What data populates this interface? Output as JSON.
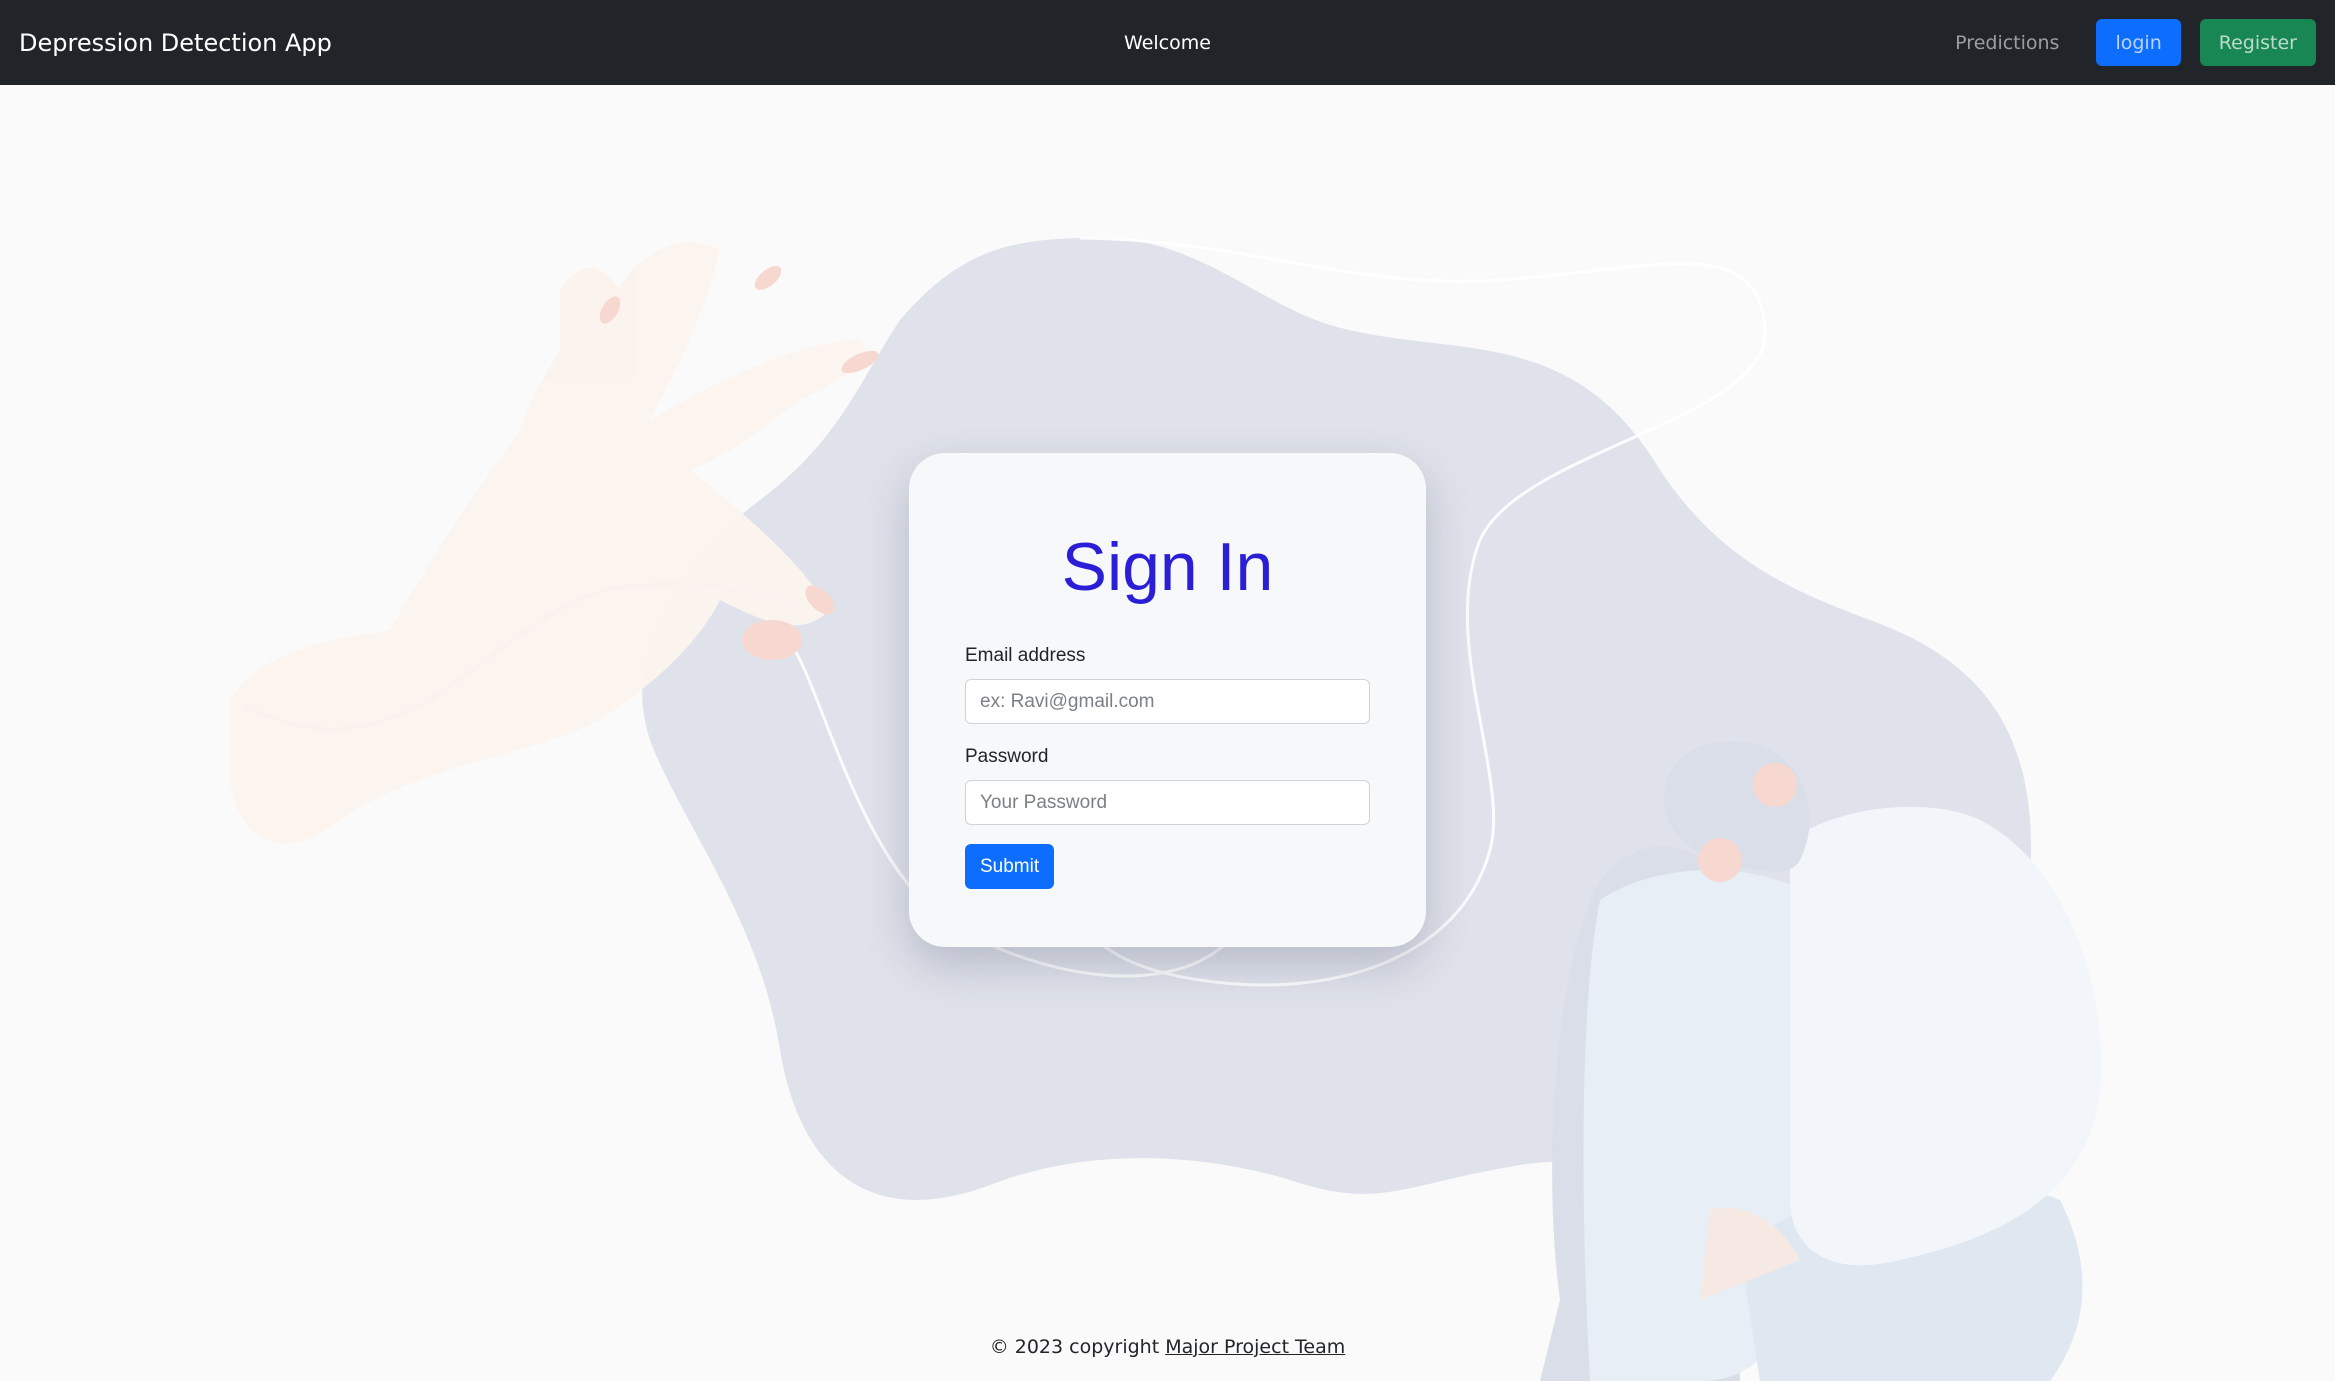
{
  "navbar": {
    "brand": "Depression Detection App",
    "center_title": "Welcome",
    "links": {
      "predictions": "Predictions",
      "login": "login",
      "register": "Register"
    }
  },
  "signin": {
    "title": "Sign In",
    "email_label": "Email address",
    "email_placeholder": "ex: Ravi@gmail.com",
    "email_value": "",
    "password_label": "Password",
    "password_placeholder": "Your Password",
    "password_value": "",
    "submit_label": "Submit"
  },
  "footer": {
    "copyright_text": "© 2023 copyright",
    "team_link": "Major Project Team"
  },
  "colors": {
    "navbar_bg": "#212529",
    "primary": "#0d6efd",
    "success": "#198754",
    "title_blue": "#2a1fd6",
    "blob": "#dfe2ea"
  },
  "icons": {
    "background": "hand-and-sad-person-illustration"
  }
}
